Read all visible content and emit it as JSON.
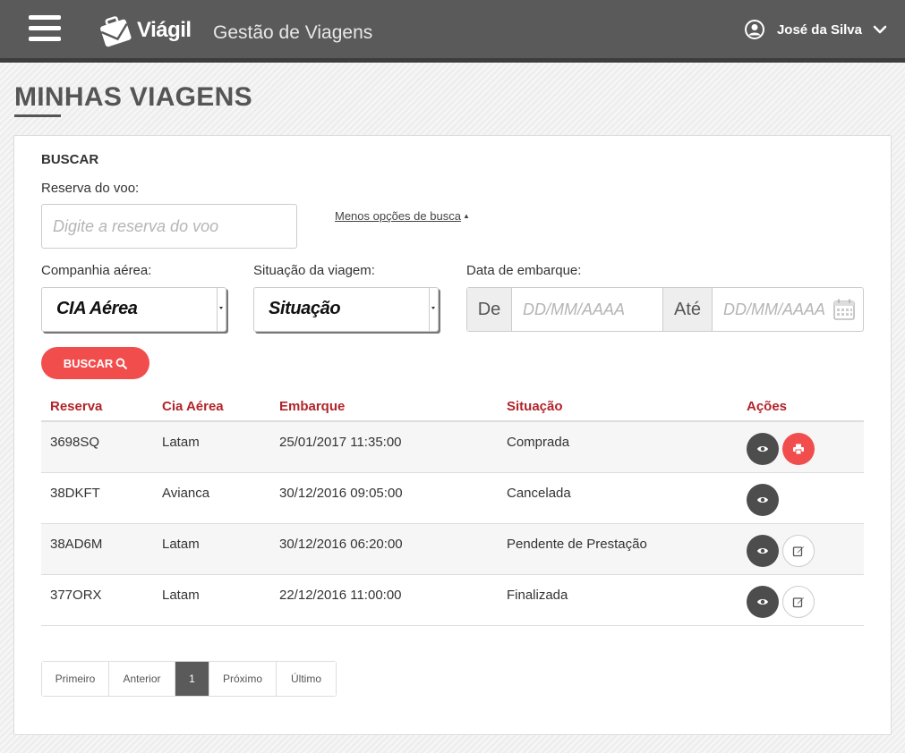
{
  "header": {
    "brand": "Viágil",
    "app_title": "Gestão de Viagens",
    "user_name": "José da Silva"
  },
  "page": {
    "title": "MINHAS VIAGENS"
  },
  "search": {
    "section_title": "BUSCAR",
    "reservation_label": "Reserva do voo:",
    "reservation_placeholder": "Digite a reserva do voo",
    "reservation_value": "",
    "less_options_link": "Menos opções de busca",
    "airline_label": "Companhia aérea:",
    "airline_selected": "CIA Aérea",
    "status_label": "Situação da viagem:",
    "status_selected": "Situação",
    "date_label": "Data de embarque:",
    "date_from_addon": "De",
    "date_from_placeholder": "DD/MM/AAAA",
    "date_to_addon": "Até",
    "date_to_placeholder": "DD/MM/AAAA",
    "button_label": "BUSCAR"
  },
  "table": {
    "headers": [
      "Reserva",
      "Cia Aérea",
      "Embarque",
      "Situação",
      "Ações"
    ],
    "rows": [
      {
        "reserva": "3698SQ",
        "cia": "Latam",
        "embarque": "25/01/2017 11:35:00",
        "situacao": "Comprada",
        "actions": [
          "eye-icon",
          "print-icon"
        ]
      },
      {
        "reserva": "38DKFT",
        "cia": "Avianca",
        "embarque": "30/12/2016 09:05:00",
        "situacao": "Cancelada",
        "actions": [
          "eye-icon"
        ]
      },
      {
        "reserva": "38AD6M",
        "cia": "Latam",
        "embarque": "30/12/2016 06:20:00",
        "situacao": "Pendente de Prestação",
        "actions": [
          "eye-icon",
          "edit-icon"
        ]
      },
      {
        "reserva": "377ORX",
        "cia": "Latam",
        "embarque": "22/12/2016 11:00:00",
        "situacao": "Finalizada",
        "actions": [
          "eye-icon",
          "edit-icon"
        ]
      }
    ]
  },
  "pagination": {
    "first": "Primeiro",
    "prev": "Anterior",
    "current": "1",
    "next": "Próximo",
    "last": "Último"
  },
  "colors": {
    "header_bg": "#5a5a5a",
    "accent_red": "#f24d4d",
    "table_header_text": "#b2242a",
    "view_button": "#4d4d4d"
  }
}
